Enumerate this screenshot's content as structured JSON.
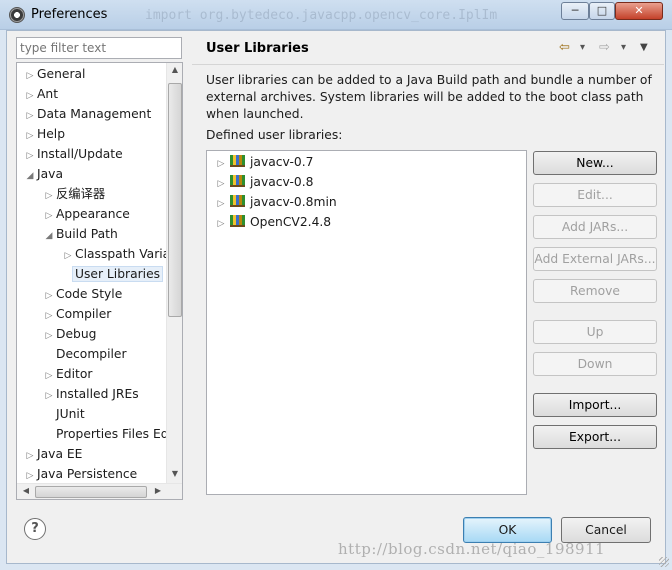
{
  "window": {
    "title": "Preferences",
    "bg_code": "import org.bytedeco.javacpp.opencv_core.IplIm",
    "min_glyph": "─",
    "max_glyph": "□",
    "close_glyph": "✕"
  },
  "filter": {
    "placeholder": "type filter text"
  },
  "tree": {
    "items": [
      {
        "label": "General",
        "expanded": false
      },
      {
        "label": "Ant",
        "expanded": false
      },
      {
        "label": "Data Management",
        "expanded": false
      },
      {
        "label": "Help",
        "expanded": false
      },
      {
        "label": "Install/Update",
        "expanded": false
      },
      {
        "label": "Java",
        "expanded": true
      },
      {
        "label": "反编译器",
        "expanded": false
      },
      {
        "label": "Appearance",
        "expanded": false
      },
      {
        "label": "Build Path",
        "expanded": true
      },
      {
        "label": "Classpath Variables",
        "expanded": false
      },
      {
        "label": "User Libraries",
        "selected": true
      },
      {
        "label": "Code Style",
        "expanded": false
      },
      {
        "label": "Compiler",
        "expanded": false
      },
      {
        "label": "Debug",
        "expanded": false
      },
      {
        "label": "Decompiler"
      },
      {
        "label": "Editor",
        "expanded": false
      },
      {
        "label": "Installed JREs",
        "expanded": false
      },
      {
        "label": "JUnit"
      },
      {
        "label": "Properties Files Editor"
      },
      {
        "label": "Java EE",
        "expanded": false
      },
      {
        "label": "Java Persistence",
        "expanded": false
      }
    ]
  },
  "page": {
    "title": "User Libraries",
    "description": "User libraries can be added to a Java Build path and bundle a number of external archives. System libraries will be added to the boot class path when launched.",
    "defined_label": "Defined user libraries:",
    "nav": {
      "back": "⇦",
      "back_menu": "▾",
      "forward": "⇨",
      "forward_menu": "▾",
      "view_menu": "▼"
    }
  },
  "libraries": [
    {
      "name": "javacv-0.7"
    },
    {
      "name": "javacv-0.8"
    },
    {
      "name": "javacv-0.8min"
    },
    {
      "name": "OpenCV2.4.8"
    }
  ],
  "buttons": {
    "new": "New...",
    "edit": "Edit...",
    "add_jars": "Add JARs...",
    "add_external_jars": "Add External JARs...",
    "remove": "Remove",
    "up": "Up",
    "down": "Down",
    "import": "Import...",
    "export": "Export..."
  },
  "footer": {
    "help": "?",
    "ok": "OK",
    "cancel": "Cancel",
    "watermark": "http://blog.csdn.net/qiao_198911"
  }
}
